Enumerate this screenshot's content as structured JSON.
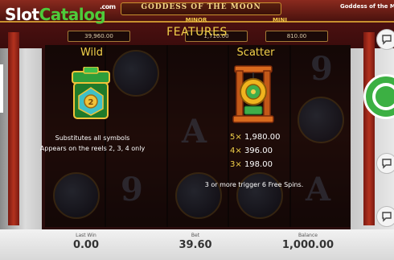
{
  "watermark": {
    "slot": "Slot",
    "catalog": "Catalog",
    "com": ".com"
  },
  "game": {
    "title": "GODDESS OF THE MOON",
    "header_right": "Goddess of the Mo"
  },
  "jackpots": [
    {
      "label": "",
      "value": "39,960.00"
    },
    {
      "label": "MINOR",
      "value": "1,710.00"
    },
    {
      "label": "MINI",
      "value": "810.00"
    }
  ],
  "features": {
    "title": "FEATURES",
    "wild": {
      "title": "Wild",
      "line1": "Substitutes all symbols",
      "line2": "Appears on the reels 2, 3, 4 only"
    },
    "scatter": {
      "title": "Scatter",
      "pays": [
        {
          "mult": "5×",
          "amount": "1,980.00"
        },
        {
          "mult": "4×",
          "amount": "396.00"
        },
        {
          "mult": "3×",
          "amount": "198.00"
        }
      ],
      "note": "3 or more trigger 6 Free Spins."
    }
  },
  "bottom": {
    "last_win": {
      "label": "Last Win",
      "value": "0.00"
    },
    "bet": {
      "label": "Bet",
      "value": "39.60"
    },
    "balance": {
      "label": "Balance",
      "value": "1,000.00"
    }
  },
  "colors": {
    "accent": "#f3d24a",
    "spin": "#3cb043",
    "logo_green": "#4ecb3a"
  },
  "icons": [
    "chat-icon",
    "spin-icon",
    "autoplay-icon",
    "close-icon",
    "wild-symbol-icon",
    "scatter-symbol-icon"
  ]
}
